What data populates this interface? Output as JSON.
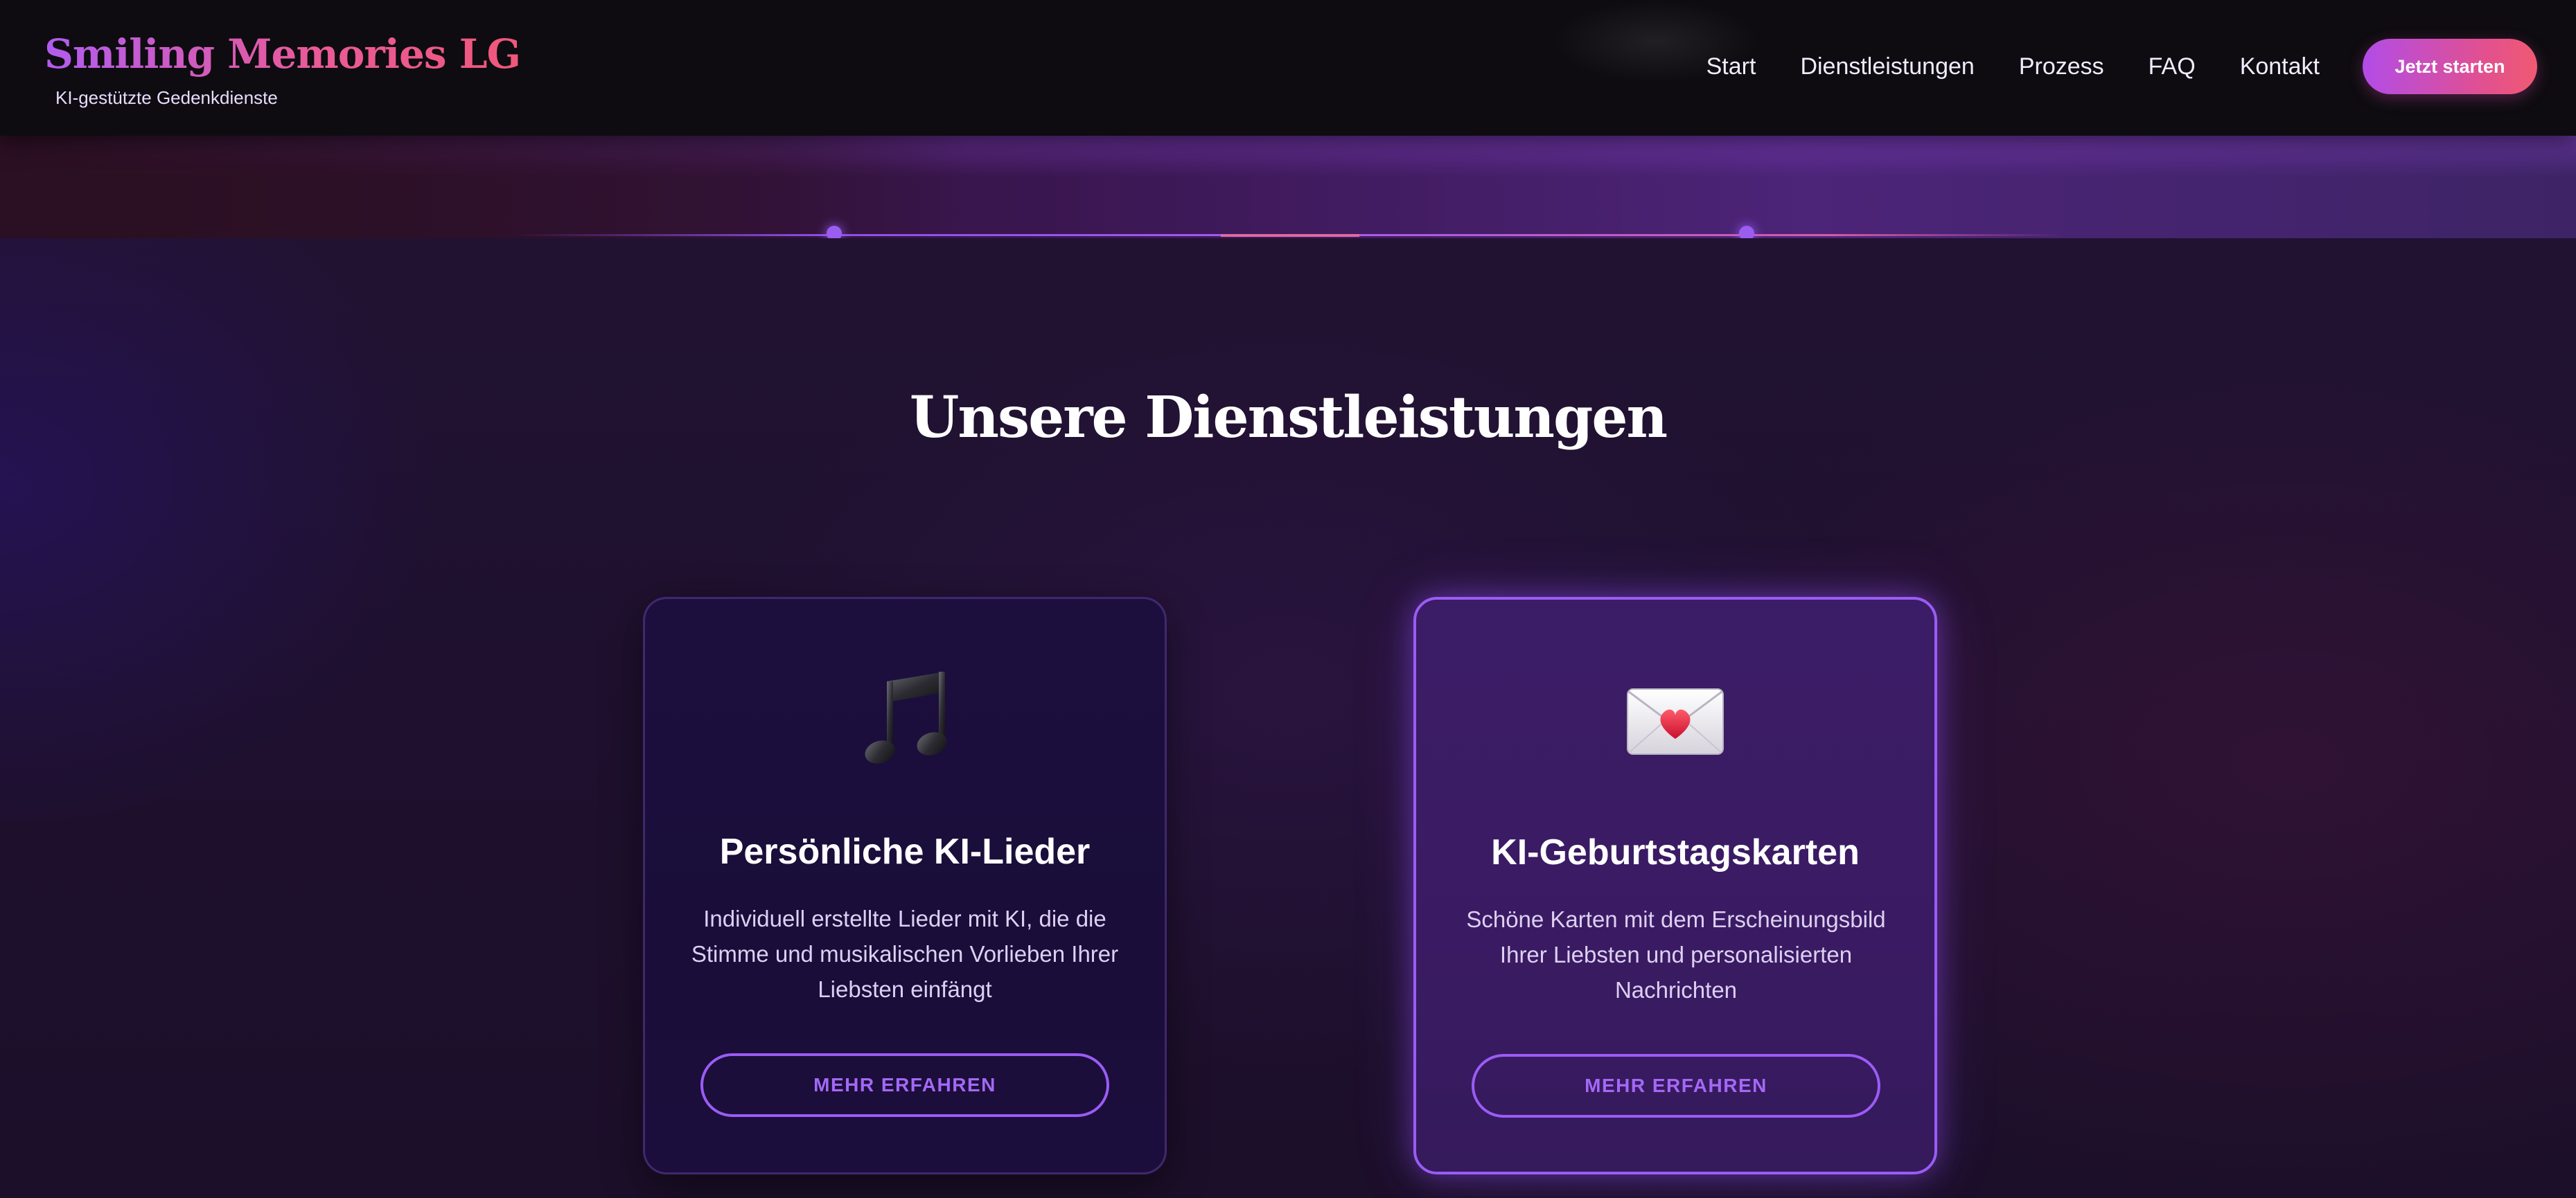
{
  "brand": {
    "title": "Smiling Memories LG",
    "tagline": "KI-gestützte Gedenkdienste"
  },
  "nav": {
    "items": [
      {
        "label": "Start"
      },
      {
        "label": "Dienstleistungen"
      },
      {
        "label": "Prozess"
      },
      {
        "label": "FAQ"
      },
      {
        "label": "Kontakt"
      }
    ],
    "cta_label": "Jetzt starten"
  },
  "services": {
    "title": "Unsere Dienstleistungen",
    "cards": [
      {
        "icon": "music-notes-icon",
        "title": "Persönliche KI-Lieder",
        "description": "Individuell erstellte Lieder mit KI, die die Stimme und musikalischen Vorlieben Ihrer Liebsten einfängt",
        "button_label": "MEHR ERFAHREN"
      },
      {
        "icon": "heart-envelope-icon",
        "title": "KI-Geburtstagskarten",
        "description": "Schöne Karten mit dem Erscheinungsbild Ihrer Liebsten und personalisierten Nachrichten",
        "button_label": "MEHR ERFAHREN"
      }
    ]
  },
  "colors": {
    "accent_purple": "#9a5cf5",
    "accent_pink": "#f05a72",
    "header_bg": "#0e0c10",
    "page_bg": "#1f1130"
  }
}
